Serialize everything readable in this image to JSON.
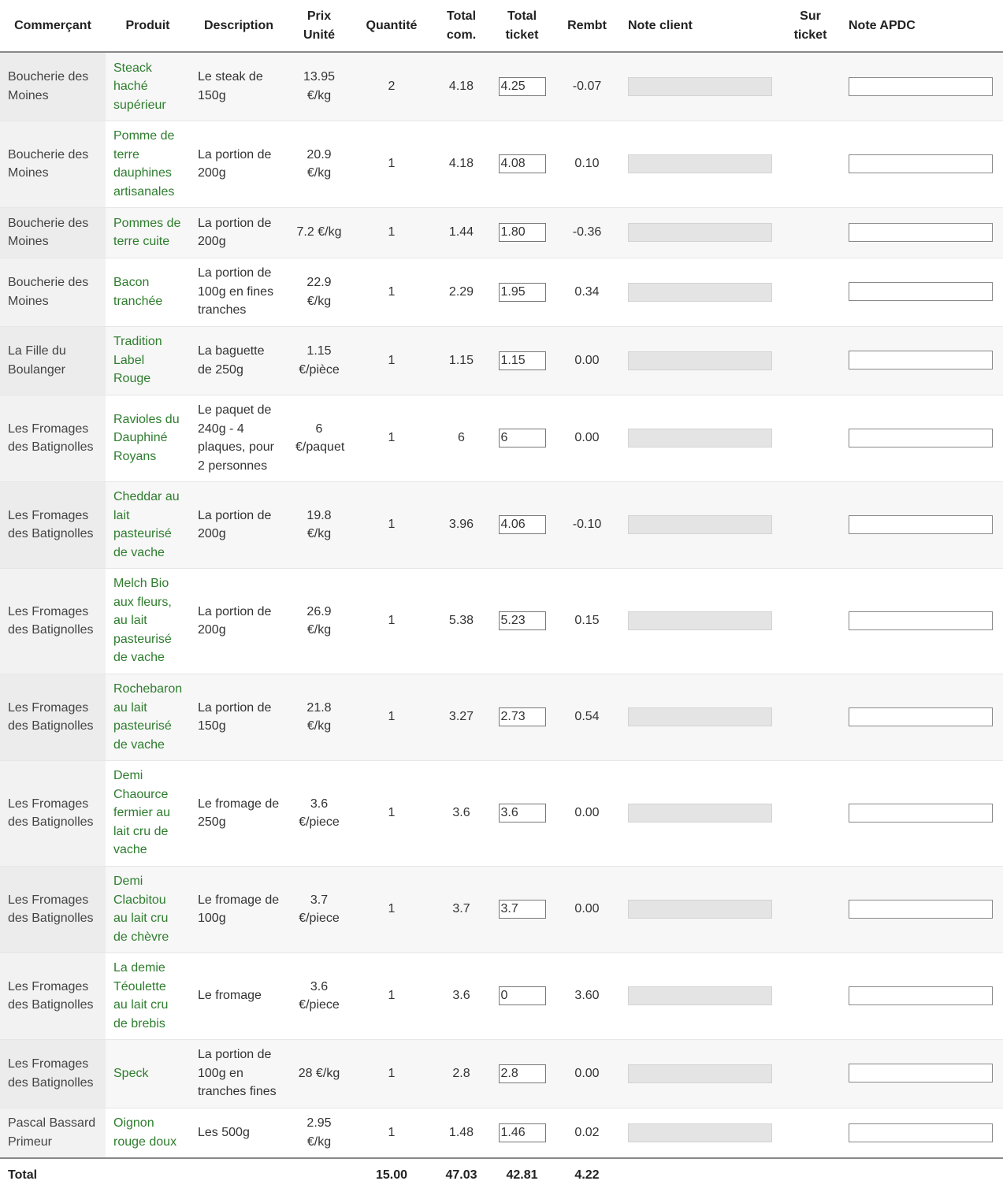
{
  "headers": {
    "merchant": "Commerçant",
    "product": "Produit",
    "description": "Description",
    "unit_price": "Prix Unité",
    "quantity": "Quantité",
    "total_order": "Total com.",
    "total_ticket": "Total ticket",
    "refund": "Rembt",
    "client_note": "Note client",
    "on_ticket": "Sur ticket",
    "apdc_note": "Note APDC"
  },
  "rows": [
    {
      "merchant": "Boucherie des Moines",
      "product": "Steack haché supérieur",
      "description": "Le steak de 150g",
      "unit_price": "13.95 €/kg",
      "quantity": "2",
      "total_order": "4.18",
      "total_ticket": "4.25",
      "refund": "-0.07"
    },
    {
      "merchant": "Boucherie des Moines",
      "product": "Pomme de terre dauphines artisanales",
      "description": "La portion de 200g",
      "unit_price": "20.9 €/kg",
      "quantity": "1",
      "total_order": "4.18",
      "total_ticket": "4.08",
      "refund": "0.10"
    },
    {
      "merchant": "Boucherie des Moines",
      "product": "Pommes de terre cuite",
      "description": "La portion de 200g",
      "unit_price": "7.2 €/kg",
      "quantity": "1",
      "total_order": "1.44",
      "total_ticket": "1.80",
      "refund": "-0.36"
    },
    {
      "merchant": "Boucherie des Moines",
      "product": "Bacon tranchée",
      "description": "La portion de 100g en fines tranches",
      "unit_price": "22.9 €/kg",
      "quantity": "1",
      "total_order": "2.29",
      "total_ticket": "1.95",
      "refund": "0.34"
    },
    {
      "merchant": "La Fille du Boulanger",
      "product": "Tradition Label Rouge",
      "description": "La baguette de 250g",
      "unit_price": "1.15 €/pièce",
      "quantity": "1",
      "total_order": "1.15",
      "total_ticket": "1.15",
      "refund": "0.00"
    },
    {
      "merchant": "Les Fromages des Batignolles",
      "product": "Ravioles du Dauphiné Royans",
      "description": "Le paquet de 240g - 4 plaques, pour 2 personnes",
      "unit_price": "6 €/paquet",
      "quantity": "1",
      "total_order": "6",
      "total_ticket": "6",
      "refund": "0.00"
    },
    {
      "merchant": "Les Fromages des Batignolles",
      "product": "Cheddar au lait pasteurisé de vache",
      "description": "La portion de 200g",
      "unit_price": "19.8 €/kg",
      "quantity": "1",
      "total_order": "3.96",
      "total_ticket": "4.06",
      "refund": "-0.10"
    },
    {
      "merchant": "Les Fromages des Batignolles",
      "product": "Melch Bio aux fleurs, au lait pasteurisé de vache",
      "description": "La portion de 200g",
      "unit_price": "26.9 €/kg",
      "quantity": "1",
      "total_order": "5.38",
      "total_ticket": "5.23",
      "refund": "0.15"
    },
    {
      "merchant": "Les Fromages des Batignolles",
      "product": "Rochebaron au lait pasteurisé de vache",
      "description": "La portion de 150g",
      "unit_price": "21.8 €/kg",
      "quantity": "1",
      "total_order": "3.27",
      "total_ticket": "2.73",
      "refund": "0.54"
    },
    {
      "merchant": "Les Fromages des Batignolles",
      "product": "Demi Chaource fermier au lait cru de vache",
      "description": "Le fromage de 250g",
      "unit_price": "3.6 €/piece",
      "quantity": "1",
      "total_order": "3.6",
      "total_ticket": "3.6",
      "refund": "0.00"
    },
    {
      "merchant": "Les Fromages des Batignolles",
      "product": "Demi Clacbitou au lait cru de chèvre",
      "description": "Le fromage de 100g",
      "unit_price": "3.7 €/piece",
      "quantity": "1",
      "total_order": "3.7",
      "total_ticket": "3.7",
      "refund": "0.00"
    },
    {
      "merchant": "Les Fromages des Batignolles",
      "product": "La demie Téoulette au lait cru de brebis",
      "description": "Le fromage",
      "unit_price": "3.6 €/piece",
      "quantity": "1",
      "total_order": "3.6",
      "total_ticket": "0",
      "refund": "3.60"
    },
    {
      "merchant": "Les Fromages des Batignolles",
      "product": "Speck",
      "description": "La portion de 100g en tranches fines",
      "unit_price": "28 €/kg",
      "quantity": "1",
      "total_order": "2.8",
      "total_ticket": "2.8",
      "refund": "0.00"
    },
    {
      "merchant": "Pascal Bassard Primeur",
      "product": "Oignon rouge doux",
      "description": "Les 500g",
      "unit_price": "2.95 €/kg",
      "quantity": "1",
      "total_order": "1.48",
      "total_ticket": "1.46",
      "refund": "0.02"
    }
  ],
  "totals": {
    "label": "Total",
    "quantity": "15.00",
    "total_order": "47.03",
    "total_ticket": "42.81",
    "refund": "4.22"
  }
}
